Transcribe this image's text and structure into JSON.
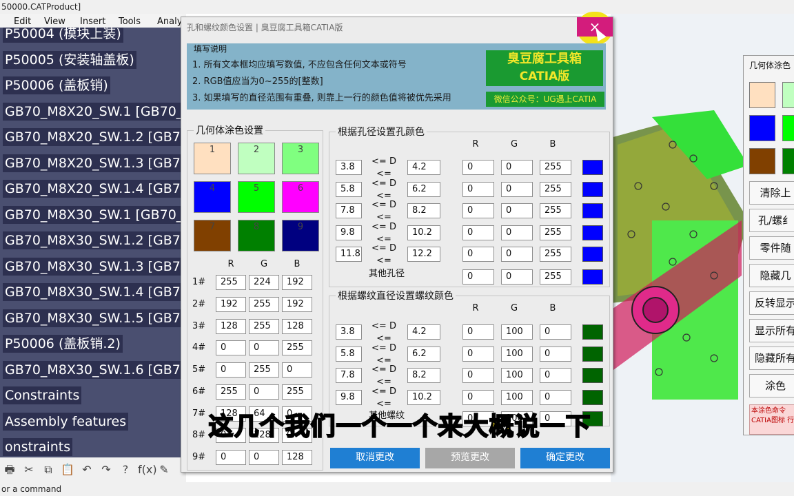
{
  "app": {
    "title": "50000.CATProduct]",
    "menu": [
      "Edit",
      "View",
      "Insert",
      "Tools",
      "Analy"
    ],
    "status": "or a command"
  },
  "tree": {
    "items": [
      "P50004 (模块上装)",
      "P50005 (安装轴盖板)",
      "P50006 (盖板销)",
      "GB70_M8X20_SW.1 [GB70_",
      "GB70_M8X20_SW.1.2 [GB7",
      "GB70_M8X20_SW.1.3 [GB7",
      "GB70_M8X20_SW.1.4 [GB7",
      "GB70_M8X30_SW.1 [GB70_",
      "GB70_M8X30_SW.1.2 [GB7",
      "GB70_M8X30_SW.1.3 [GB7",
      "GB70_M8X30_SW.1.4 [GB7",
      "GB70_M8X30_SW.1.5 [GB7",
      "P50006 (盖板销.2)",
      "GB70_M8X30_SW.1.6 [GB7",
      "Constraints",
      "Assembly features",
      "onstraints"
    ]
  },
  "toolbar": {
    "icons": [
      "printer-icon",
      "cut-icon",
      "copy-icon",
      "paste-icon",
      "undo-icon",
      "redo-icon",
      "whats-this-icon",
      "formula-icon",
      "comment-icon"
    ],
    "glyphs": [
      "🖶",
      "✂",
      "⧉",
      "📋",
      "↶",
      "↷",
      "?",
      "f(x)",
      "✎"
    ]
  },
  "sidepanel": {
    "title": "几何体涂色",
    "swatches": [
      "#ffe0c0",
      "#c0ffc0",
      "#0000ff",
      "#00ff00",
      "#804000",
      "#008000"
    ],
    "buttons": [
      "清除上",
      "孔/螺纟",
      "零件随",
      "隐藏几",
      "反转显示",
      "显示所有",
      "隐藏所有",
      "涂色"
    ],
    "note": "本涂色命令 CATIA图标 行"
  },
  "dialog": {
    "title": "孔和螺纹颜色设置 | 臭豆腐工具箱CATIA版",
    "close": "×",
    "info": {
      "title": "填写说明",
      "lines": [
        "1. 所有文本框均应填写数值, 不应包含任何文本或符号",
        "2. RGB值应当为0~255的[整数]",
        "3. 如果填写的直径范围有重叠, 则靠上一行的颜色值将被优先采用"
      ],
      "brand_line1": "臭豆腐工具箱",
      "brand_line2": "CATIA版",
      "wechat": "微信公众号：UG遇上CATIA"
    },
    "geom": {
      "label": "几何体涂色设置",
      "swatch_labels": [
        "1",
        "2",
        "3",
        "4",
        "5",
        "6",
        "7",
        "8",
        "9"
      ],
      "swatch_colors": [
        "#ffe0c0",
        "#c0ffc0",
        "#80ff80",
        "#0000ff",
        "#00ff00",
        "#ff00ff",
        "#804000",
        "#008000",
        "#000080"
      ],
      "headers": [
        "R",
        "G",
        "B"
      ],
      "rows": [
        {
          "label": "1#",
          "r": "255",
          "g": "224",
          "b": "192"
        },
        {
          "label": "2#",
          "r": "192",
          "g": "255",
          "b": "192"
        },
        {
          "label": "3#",
          "r": "128",
          "g": "255",
          "b": "128"
        },
        {
          "label": "4#",
          "r": "0",
          "g": "0",
          "b": "255"
        },
        {
          "label": "5#",
          "r": "0",
          "g": "255",
          "b": "0"
        },
        {
          "label": "6#",
          "r": "255",
          "g": "0",
          "b": "255"
        },
        {
          "label": "7#",
          "r": "128",
          "g": "64",
          "b": "0"
        },
        {
          "label": "8#",
          "r": "0",
          "g": "128",
          "b": "0"
        },
        {
          "label": "9#",
          "r": "0",
          "g": "0",
          "b": "128"
        }
      ]
    },
    "hole": {
      "label": "根据孔径设置孔颜色",
      "headers": [
        "R",
        "G",
        "B"
      ],
      "op": "<= D <=",
      "rows": [
        {
          "min": "3.8",
          "max": "4.2",
          "r": "0",
          "g": "0",
          "b": "255",
          "color": "#0000ff"
        },
        {
          "min": "5.8",
          "max": "6.2",
          "r": "0",
          "g": "0",
          "b": "255",
          "color": "#0000ff"
        },
        {
          "min": "7.8",
          "max": "8.2",
          "r": "0",
          "g": "0",
          "b": "255",
          "color": "#0000ff"
        },
        {
          "min": "9.8",
          "max": "10.2",
          "r": "0",
          "g": "0",
          "b": "255",
          "color": "#0000ff"
        },
        {
          "min": "11.8",
          "max": "12.2",
          "r": "0",
          "g": "0",
          "b": "255",
          "color": "#0000ff"
        }
      ],
      "other": {
        "label": "其他孔径",
        "r": "0",
        "g": "0",
        "b": "255",
        "color": "#0000ff"
      }
    },
    "thread": {
      "label": "根据螺纹直径设置螺纹颜色",
      "headers": [
        "R",
        "G",
        "B"
      ],
      "op": "<= D <=",
      "rows": [
        {
          "min": "3.8",
          "max": "4.2",
          "r": "0",
          "g": "100",
          "b": "0",
          "color": "#006400"
        },
        {
          "min": "5.8",
          "max": "6.2",
          "r": "0",
          "g": "100",
          "b": "0",
          "color": "#006400"
        },
        {
          "min": "7.8",
          "max": "8.2",
          "r": "0",
          "g": "100",
          "b": "0",
          "color": "#006400"
        },
        {
          "min": "9.8",
          "max": "10.2",
          "r": "0",
          "g": "100",
          "b": "0",
          "color": "#006400"
        }
      ],
      "other": {
        "label": "其他螺纹",
        "r": "0",
        "g": "100",
        "b": "0",
        "color": "#006400"
      }
    },
    "buttons": [
      {
        "label": "取消更改",
        "bg": "#1f7fd3",
        "fg": "#ffffff"
      },
      {
        "label": "预览更改",
        "bg": "#a7a7a7",
        "fg": "#ffffff"
      },
      {
        "label": "确定更改",
        "bg": "#1f7fd3",
        "fg": "#ffffff"
      }
    ]
  },
  "subtitle": "这几个我们一个一个来大概说一下"
}
